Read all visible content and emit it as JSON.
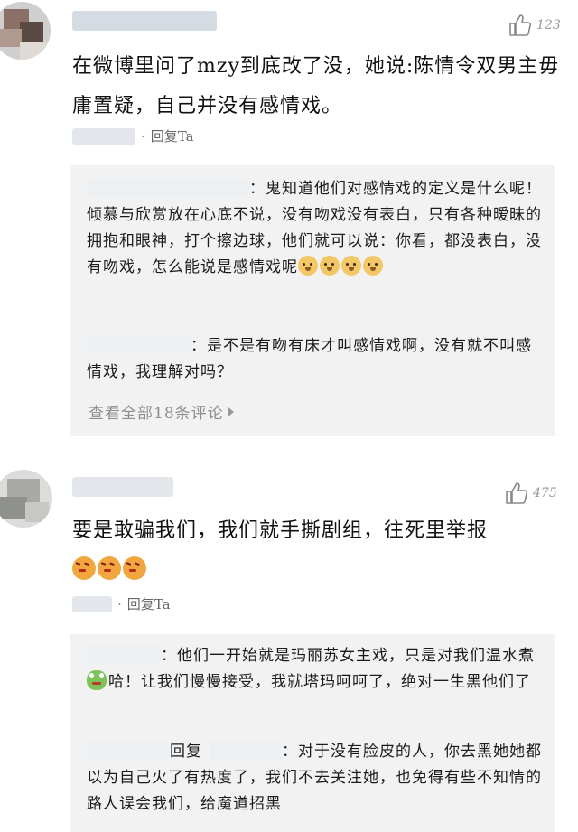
{
  "comments": [
    {
      "likes": "123",
      "text": "在微博里问了mzy到底改了没，她说:陈情令双男主毋庸置疑，自己并没有感情戏。",
      "reply_label": "回复Ta",
      "dot": "·",
      "replies": [
        {
          "text": "：鬼知道他们对感情戏的定义是什么呢！倾慕与欣赏放在心底不说，没有吻戏没有表白，只有各种暧昧的拥抱和眼神，打个擦边球，他们就可以说：你看，都没表白，没有吻戏，怎么能说是感情戏呢",
          "emojis": [
            "doge",
            "doge",
            "doge",
            "doge"
          ]
        },
        {
          "text": "：是不是有吻有床才叫感情戏啊，没有就不叫感情戏，我理解对吗？"
        }
      ],
      "view_all": "查看全部18条评论"
    },
    {
      "likes": "475",
      "text": "要是敢骗我们，我们就手撕剧组，往死里举报",
      "emojis": [
        "angry",
        "angry",
        "angry"
      ],
      "reply_label": "回复Ta",
      "dot": "·",
      "replies": [
        {
          "text_before": "：他们一开始就是玛丽苏女主戏，只是对我们温水煮",
          "emoji": "frog",
          "text_after": "哈！让我们慢慢接受，我就塔玛呵呵了，绝对一生黑他们了"
        },
        {
          "reply_word": "回复",
          "text": "：对于没有脸皮的人，你去黑她她都以为自己火了有热度了，我们不去关注她，也免得有些不知情的路人误会我们，给魔道招黑"
        }
      ]
    }
  ],
  "icons": {
    "like": "thumbs-up-icon",
    "more": "triangle-right-icon"
  },
  "colors": {
    "reply_bg": "#f2f2f2",
    "muted": "#8c8c8c"
  }
}
